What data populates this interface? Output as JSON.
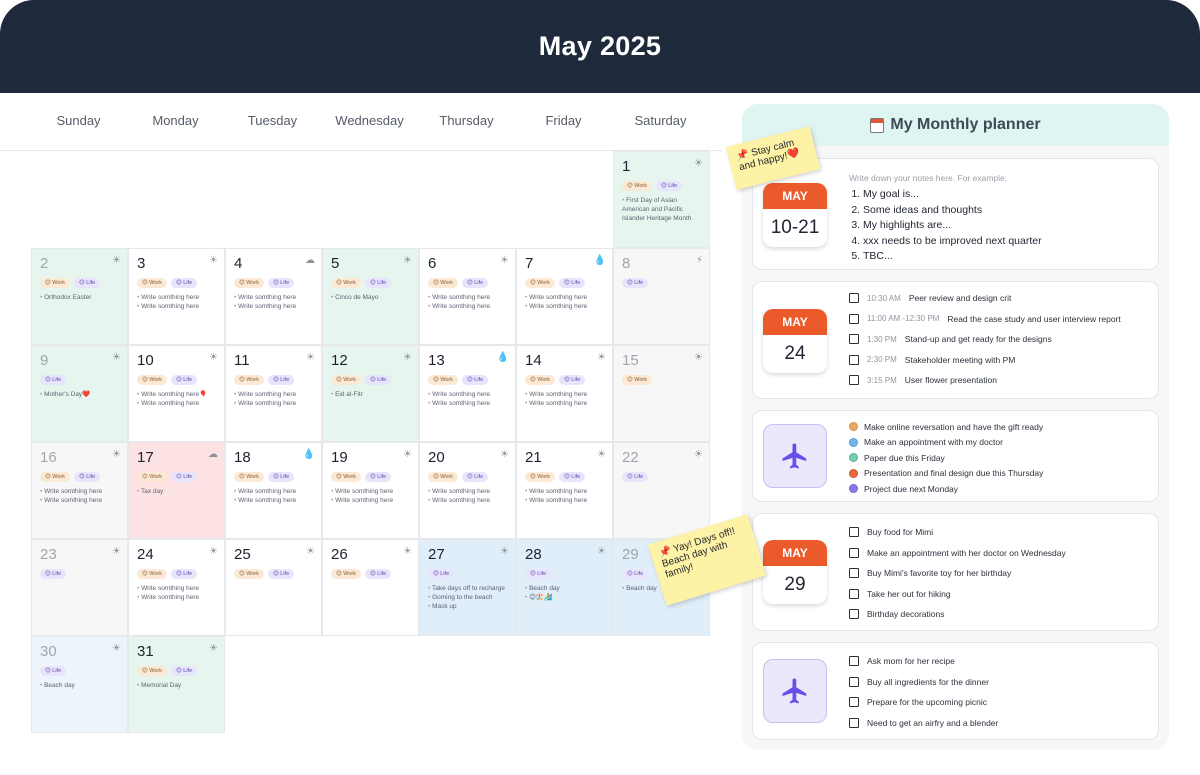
{
  "header": {
    "title": "May 2025"
  },
  "weekdays": [
    "Sunday",
    "Monday",
    "Tuesday",
    "Wednesday",
    "Thursday",
    "Friday",
    "Saturday"
  ],
  "weather_icons": {
    "sun": "sun-icon",
    "cloud": "cloud-icon",
    "rain": "raindrop-icon",
    "storm": "lightning-icon"
  },
  "tag_labels": {
    "work": "😊 Work",
    "life": "😊 Life"
  },
  "days": [
    {
      "n": "1",
      "weather": "☀",
      "tags": [
        "work",
        "life"
      ],
      "notes": [
        "First Day of Asian American and Pacific Islander Heritage Month"
      ]
    },
    {
      "n": "2",
      "weather": "☀",
      "tags": [
        "work",
        "life"
      ],
      "notes": [
        "Orthodox Easter"
      ]
    },
    {
      "n": "3",
      "weather": "☀",
      "tags": [
        "work",
        "life"
      ],
      "notes": [
        "Write somthing here",
        "Write somthing here"
      ]
    },
    {
      "n": "4",
      "weather": "☁",
      "tags": [
        "work",
        "life"
      ],
      "notes": [
        "Write somthing here",
        "Write somthing here"
      ]
    },
    {
      "n": "5",
      "weather": "☀",
      "tags": [
        "work",
        "life"
      ],
      "notes": [
        "Cinco de Mayo"
      ]
    },
    {
      "n": "6",
      "weather": "☀",
      "tags": [
        "work",
        "life"
      ],
      "notes": [
        "Write somthing here",
        "Write somthing here"
      ]
    },
    {
      "n": "7",
      "weather": "💧",
      "tags": [
        "work",
        "life"
      ],
      "notes": [
        "Write somthing here",
        "Write somthing here"
      ]
    },
    {
      "n": "8",
      "weather": "⚡",
      "tags": [
        "life"
      ],
      "notes": []
    },
    {
      "n": "9",
      "weather": "☀",
      "tags": [
        "life"
      ],
      "notes": [
        "Mother's Day❤️"
      ]
    },
    {
      "n": "10",
      "weather": "☀",
      "tags": [
        "work",
        "life"
      ],
      "notes": [
        "Write somthing here🎈",
        "Write somthing here"
      ]
    },
    {
      "n": "11",
      "weather": "☀",
      "tags": [
        "work",
        "life"
      ],
      "notes": [
        "Write somthing here",
        "Write somthing here"
      ]
    },
    {
      "n": "12",
      "weather": "☀",
      "tags": [
        "work",
        "life"
      ],
      "notes": [
        "Eid al-Fitr"
      ]
    },
    {
      "n": "13",
      "weather": "💧",
      "tags": [
        "work",
        "life"
      ],
      "notes": [
        "Write somthing here",
        "Write somthing here"
      ]
    },
    {
      "n": "14",
      "weather": "☀",
      "tags": [
        "work",
        "life"
      ],
      "notes": [
        "Write somthing here",
        "Write somthing here"
      ]
    },
    {
      "n": "15",
      "weather": "☀",
      "tags": [
        "work"
      ],
      "notes": []
    },
    {
      "n": "16",
      "weather": "☀",
      "tags": [
        "work",
        "life"
      ],
      "notes": [
        "Write somthing here",
        "Write somthing here"
      ]
    },
    {
      "n": "17",
      "weather": "☁",
      "tags": [
        "work",
        "life"
      ],
      "notes": [
        "Tax day"
      ]
    },
    {
      "n": "18",
      "weather": "💧",
      "tags": [
        "work",
        "life"
      ],
      "notes": [
        "Write somthing here",
        "Write somthing here"
      ]
    },
    {
      "n": "19",
      "weather": "☀",
      "tags": [
        "work",
        "life"
      ],
      "notes": [
        "Write somthing here",
        "Write somthing here"
      ]
    },
    {
      "n": "20",
      "weather": "☀",
      "tags": [
        "work",
        "life"
      ],
      "notes": [
        "Write somthing here",
        "Write somthing here"
      ]
    },
    {
      "n": "21",
      "weather": "☀",
      "tags": [
        "work",
        "life"
      ],
      "notes": [
        "Write somthing here",
        "Write somthing here"
      ]
    },
    {
      "n": "22",
      "weather": "☀",
      "tags": [
        "life"
      ],
      "notes": []
    },
    {
      "n": "23",
      "weather": "☀",
      "tags": [
        "life"
      ],
      "notes": []
    },
    {
      "n": "24",
      "weather": "☀",
      "tags": [
        "work",
        "life"
      ],
      "notes": [
        "Write somthing here",
        "Write somthing here"
      ]
    },
    {
      "n": "25",
      "weather": "☀",
      "tags": [
        "work",
        "life"
      ],
      "notes": []
    },
    {
      "n": "26",
      "weather": "☀",
      "tags": [
        "work",
        "life"
      ],
      "notes": []
    },
    {
      "n": "27",
      "weather": "☀",
      "tags": [
        "life"
      ],
      "notes": [
        "Take days off to recharge",
        "Goming to the beach",
        "Mask up"
      ]
    },
    {
      "n": "28",
      "weather": "☀",
      "tags": [
        "life"
      ],
      "notes": [
        "Beach day",
        "😊🏖️🏄"
      ]
    },
    {
      "n": "29",
      "weather": "☀",
      "tags": [
        "life"
      ],
      "notes": [
        "Beach day"
      ]
    },
    {
      "n": "30",
      "weather": "☀",
      "tags": [
        "life"
      ],
      "notes": [
        "Beach day"
      ]
    },
    {
      "n": "31",
      "weather": "☀",
      "tags": [
        "work",
        "life"
      ],
      "notes": [
        "Memorial Day"
      ]
    }
  ],
  "planner": {
    "title": "My Monthly planner",
    "intro": {
      "month": "MAY",
      "day": "10-21",
      "hint": "Write down your notes here. For example:",
      "items": [
        "My goal is...",
        "Some ideas and thoughts",
        "My highlights are...",
        "xxx needs to be improved next quarter",
        "TBC..."
      ]
    },
    "schedule": {
      "month": "MAY",
      "day": "24",
      "items": [
        {
          "time": "10:30 AM",
          "text": "Peer review and design crit"
        },
        {
          "time": "11:00 AM -12:30 PM",
          "text": "Read the case study and user interview report"
        },
        {
          "time": "1:30 PM",
          "text": "Stand-up and get ready for the designs"
        },
        {
          "time": "2:30 PM",
          "text": "Stakeholder meeting with PM"
        },
        {
          "time": "3:15 PM",
          "text": "User flower presentation"
        }
      ]
    },
    "travel": {
      "icon": "airplane-icon",
      "items": [
        {
          "color": "#f0a860",
          "text": "Make online reversation and have the gift ready"
        },
        {
          "color": "#6cb6ec",
          "text": "Make an appointment with my doctor"
        },
        {
          "color": "#72d0b4",
          "text": "Paper due this Friday"
        },
        {
          "color": "#ea6a3a",
          "text": "Presentation and final design due this Thursday"
        },
        {
          "color": "#8a78ea",
          "text": "Project due next Monday"
        }
      ]
    },
    "mimi": {
      "month": "MAY",
      "day": "29",
      "items": [
        "Buy food for Mimi",
        "Make an appointment with her doctor on Wednesday",
        "Buy Mimi's favorite toy for her birthday",
        "Take her out for hiking",
        "Birthday decorations"
      ]
    },
    "picnic": {
      "icon": "airplane-icon",
      "items": [
        "Ask mom for her recipe",
        "Buy all ingredients for the dinner",
        "Prepare for the upcoming picnic",
        "Need to get an airfry and a blender"
      ]
    }
  },
  "stickies": {
    "calm": "📌 Stay calm and happy!❤️",
    "yay": "📌 Yay! Days off!! Beach day with family!"
  }
}
